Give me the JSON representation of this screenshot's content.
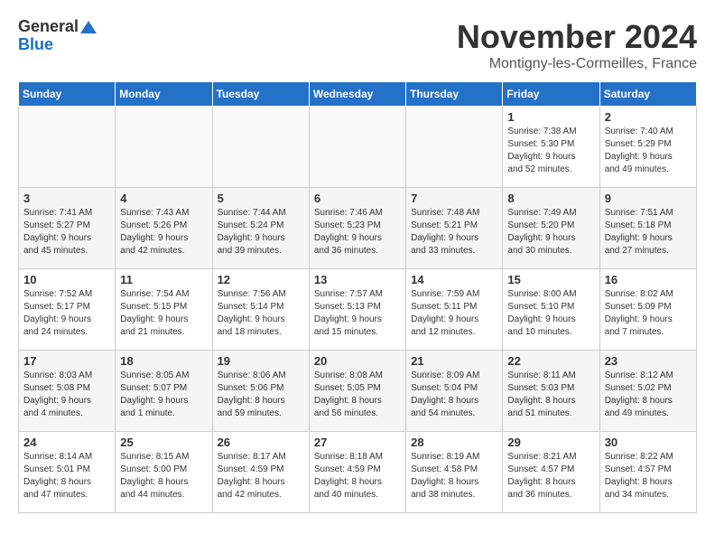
{
  "logo": {
    "general": "General",
    "blue": "Blue"
  },
  "title": {
    "month": "November 2024",
    "location": "Montigny-les-Cormeilles, France"
  },
  "headers": [
    "Sunday",
    "Monday",
    "Tuesday",
    "Wednesday",
    "Thursday",
    "Friday",
    "Saturday"
  ],
  "weeks": [
    [
      {
        "day": "",
        "info": ""
      },
      {
        "day": "",
        "info": ""
      },
      {
        "day": "",
        "info": ""
      },
      {
        "day": "",
        "info": ""
      },
      {
        "day": "",
        "info": ""
      },
      {
        "day": "1",
        "info": "Sunrise: 7:38 AM\nSunset: 5:30 PM\nDaylight: 9 hours\nand 52 minutes."
      },
      {
        "day": "2",
        "info": "Sunrise: 7:40 AM\nSunset: 5:29 PM\nDaylight: 9 hours\nand 49 minutes."
      }
    ],
    [
      {
        "day": "3",
        "info": "Sunrise: 7:41 AM\nSunset: 5:27 PM\nDaylight: 9 hours\nand 45 minutes."
      },
      {
        "day": "4",
        "info": "Sunrise: 7:43 AM\nSunset: 5:26 PM\nDaylight: 9 hours\nand 42 minutes."
      },
      {
        "day": "5",
        "info": "Sunrise: 7:44 AM\nSunset: 5:24 PM\nDaylight: 9 hours\nand 39 minutes."
      },
      {
        "day": "6",
        "info": "Sunrise: 7:46 AM\nSunset: 5:23 PM\nDaylight: 9 hours\nand 36 minutes."
      },
      {
        "day": "7",
        "info": "Sunrise: 7:48 AM\nSunset: 5:21 PM\nDaylight: 9 hours\nand 33 minutes."
      },
      {
        "day": "8",
        "info": "Sunrise: 7:49 AM\nSunset: 5:20 PM\nDaylight: 9 hours\nand 30 minutes."
      },
      {
        "day": "9",
        "info": "Sunrise: 7:51 AM\nSunset: 5:18 PM\nDaylight: 9 hours\nand 27 minutes."
      }
    ],
    [
      {
        "day": "10",
        "info": "Sunrise: 7:52 AM\nSunset: 5:17 PM\nDaylight: 9 hours\nand 24 minutes."
      },
      {
        "day": "11",
        "info": "Sunrise: 7:54 AM\nSunset: 5:15 PM\nDaylight: 9 hours\nand 21 minutes."
      },
      {
        "day": "12",
        "info": "Sunrise: 7:56 AM\nSunset: 5:14 PM\nDaylight: 9 hours\nand 18 minutes."
      },
      {
        "day": "13",
        "info": "Sunrise: 7:57 AM\nSunset: 5:13 PM\nDaylight: 9 hours\nand 15 minutes."
      },
      {
        "day": "14",
        "info": "Sunrise: 7:59 AM\nSunset: 5:11 PM\nDaylight: 9 hours\nand 12 minutes."
      },
      {
        "day": "15",
        "info": "Sunrise: 8:00 AM\nSunset: 5:10 PM\nDaylight: 9 hours\nand 10 minutes."
      },
      {
        "day": "16",
        "info": "Sunrise: 8:02 AM\nSunset: 5:09 PM\nDaylight: 9 hours\nand 7 minutes."
      }
    ],
    [
      {
        "day": "17",
        "info": "Sunrise: 8:03 AM\nSunset: 5:08 PM\nDaylight: 9 hours\nand 4 minutes."
      },
      {
        "day": "18",
        "info": "Sunrise: 8:05 AM\nSunset: 5:07 PM\nDaylight: 9 hours\nand 1 minute."
      },
      {
        "day": "19",
        "info": "Sunrise: 8:06 AM\nSunset: 5:06 PM\nDaylight: 8 hours\nand 59 minutes."
      },
      {
        "day": "20",
        "info": "Sunrise: 8:08 AM\nSunset: 5:05 PM\nDaylight: 8 hours\nand 56 minutes."
      },
      {
        "day": "21",
        "info": "Sunrise: 8:09 AM\nSunset: 5:04 PM\nDaylight: 8 hours\nand 54 minutes."
      },
      {
        "day": "22",
        "info": "Sunrise: 8:11 AM\nSunset: 5:03 PM\nDaylight: 8 hours\nand 51 minutes."
      },
      {
        "day": "23",
        "info": "Sunrise: 8:12 AM\nSunset: 5:02 PM\nDaylight: 8 hours\nand 49 minutes."
      }
    ],
    [
      {
        "day": "24",
        "info": "Sunrise: 8:14 AM\nSunset: 5:01 PM\nDaylight: 8 hours\nand 47 minutes."
      },
      {
        "day": "25",
        "info": "Sunrise: 8:15 AM\nSunset: 5:00 PM\nDaylight: 8 hours\nand 44 minutes."
      },
      {
        "day": "26",
        "info": "Sunrise: 8:17 AM\nSunset: 4:59 PM\nDaylight: 8 hours\nand 42 minutes."
      },
      {
        "day": "27",
        "info": "Sunrise: 8:18 AM\nSunset: 4:59 PM\nDaylight: 8 hours\nand 40 minutes."
      },
      {
        "day": "28",
        "info": "Sunrise: 8:19 AM\nSunset: 4:58 PM\nDaylight: 8 hours\nand 38 minutes."
      },
      {
        "day": "29",
        "info": "Sunrise: 8:21 AM\nSunset: 4:57 PM\nDaylight: 8 hours\nand 36 minutes."
      },
      {
        "day": "30",
        "info": "Sunrise: 8:22 AM\nSunset: 4:57 PM\nDaylight: 8 hours\nand 34 minutes."
      }
    ]
  ]
}
